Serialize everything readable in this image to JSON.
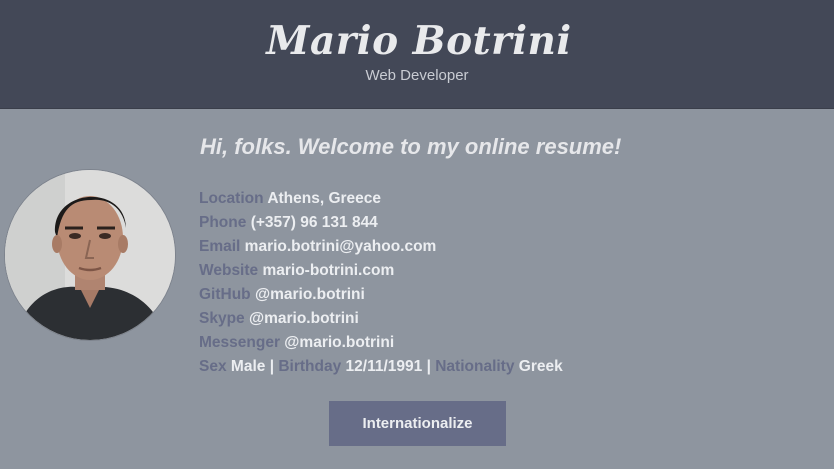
{
  "header": {
    "name": "Mario Botrini",
    "role": "Web Developer"
  },
  "main": {
    "welcome": "Hi, folks. Welcome to my online resume!",
    "info": [
      {
        "label": "Location",
        "value": "Athens, Greece"
      },
      {
        "label": "Phone",
        "value": "(+357) 96 131 844"
      },
      {
        "label": "Email",
        "value": "mario.botrini@yahoo.com"
      },
      {
        "label": "Website",
        "value": "mario-botrini.com"
      },
      {
        "label": "GitHub",
        "value": "@mario.botrini"
      },
      {
        "label": "Skype",
        "value": "@mario.botrini"
      },
      {
        "label": "Messenger",
        "value": "@mario.botrini"
      }
    ],
    "details": {
      "sex_label": "Sex",
      "sex_value": "Male",
      "separator": "|",
      "birthday_label": "Birthday",
      "birthday_value": "12/11/1991",
      "nationality_label": "Nationality",
      "nationality_value": "Greek"
    },
    "button_label": "Internationalize"
  },
  "colors": {
    "header_bg": "#434857",
    "page_bg": "#8e959f",
    "label": "#676d88",
    "value": "#eceef1",
    "button_bg": "#676d88"
  }
}
